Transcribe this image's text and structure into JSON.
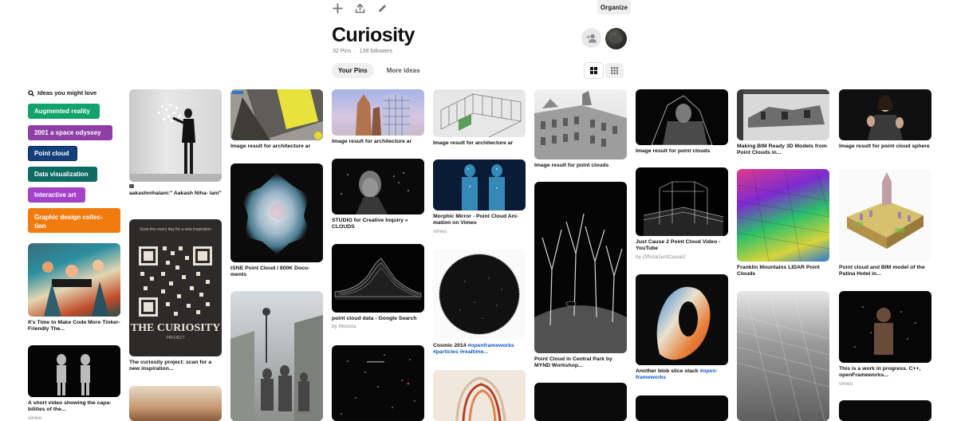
{
  "toolbar": {
    "organize_label": "Organize"
  },
  "board": {
    "title": "Curiosity",
    "pins_count": "32 Pins",
    "separator": "·",
    "followers": "139 followers"
  },
  "tabs": {
    "your_pins": "Your Pins",
    "more_ideas": "More ideas"
  },
  "ideas": {
    "heading": "Ideas you might love",
    "chips": [
      {
        "label": "Augmented reality",
        "color": "#11a36a"
      },
      {
        "label": "2001 a space odyssey",
        "color": "#8e3ea6"
      },
      {
        "label": "Point cloud",
        "color": "#13407a"
      },
      {
        "label": "Data visualization",
        "color": "#0e6b63"
      },
      {
        "label": "Interactive art",
        "color": "#a442c9"
      },
      {
        "label": "Graphic design collec- tion",
        "color": "#f07c10"
      }
    ]
  },
  "pins": {
    "c0p0": {
      "caption": "It's Time to Make Code More Tinker-Friendly The..."
    },
    "c0p1": {
      "caption": "A short video showing the capa- bilities of the...",
      "source": "vimeo"
    },
    "c1p0": {
      "caption": "aakashnihalani:\" Aakash Niha- lani\""
    },
    "c1p1": {
      "caption": "The curiosity project: scan for a new inspiration..."
    },
    "c2p0": {
      "caption": "Image result for architecture ar"
    },
    "c2p1": {
      "caption": "tSNE Point Cloud / 800K Docu- ments"
    },
    "c3p0": {
      "caption": "Image result for architecture ar"
    },
    "c3p1": {
      "caption": "STUDIO for Creative Inquiry » CLOUDS"
    },
    "c3p2": {
      "caption": "point cloud data - Google Search",
      "source": "by Movura"
    },
    "c4p0": {
      "caption": "Image result for architecture ar"
    },
    "c4p1": {
      "caption": "Morphic Mirror - Point Cloud Ani- mation on Vimeo",
      "source": "vimeo"
    },
    "c4p2": {
      "caption": "Cosmic 2014 ",
      "tag": "#openframeworks #particles #realtime..."
    },
    "c5p0": {
      "caption": "Image result for point clouds"
    },
    "c5p1": {
      "caption": "Point Cloud in Central Park by MYND Workshop..."
    },
    "c6p0": {
      "caption": "Image result for point clouds"
    },
    "c6p1": {
      "caption": "Just Cause 2 Point Cloud Video - YouTube",
      "source": "by OfficialJustCause2"
    },
    "c6p2": {
      "caption": "Another blob slice stack ",
      "tag": "#open- frameworks"
    },
    "c7p0": {
      "caption": "Making BIM Ready 3D Models from Point Clouds in..."
    },
    "c7p1": {
      "caption": "Franklin Mountains LIDAR Point Clouds"
    },
    "c8p0": {
      "caption": "Image result for point cloud sphere"
    },
    "c8p1": {
      "caption": "Point cloud and BIM model of the Patina Hotel in..."
    },
    "c8p2": {
      "caption": "This is a work in progress. C++, openFrameworks...",
      "source": "vimeo"
    }
  },
  "poster": {
    "scan_text": "Scan this every day for a new inspiration",
    "title": "THE CURIOSITY",
    "subtitle": "PROJECT"
  }
}
